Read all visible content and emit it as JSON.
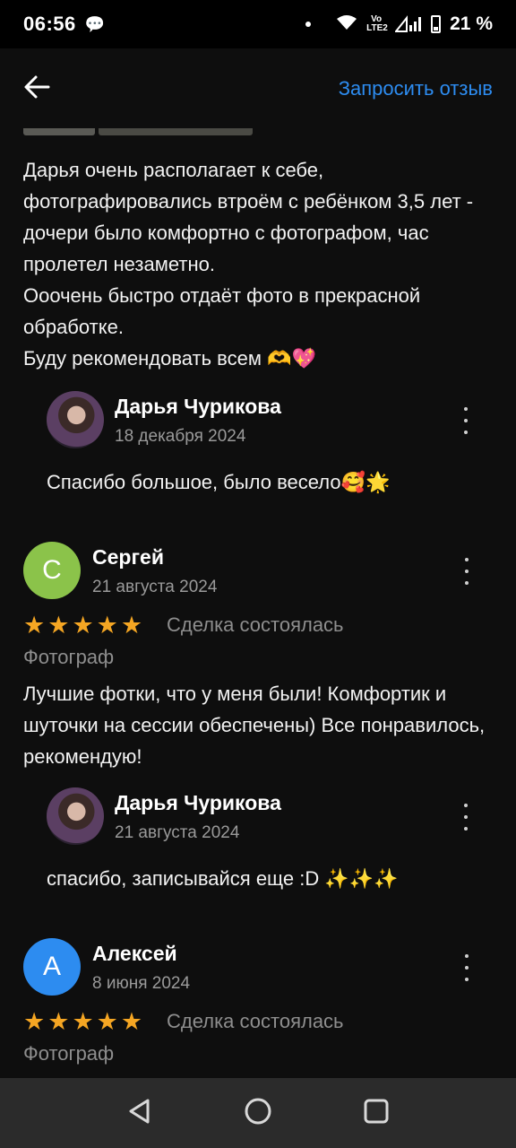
{
  "status": {
    "time": "06:56",
    "volte": "Vo LTE2",
    "battery": "21 %"
  },
  "header": {
    "back_icon": "arrow-left-icon",
    "request_review_label": "Запросить отзыв"
  },
  "reviews": [
    {
      "text": "Дарья очень располагает к себе, фотографировались втроём с ребёнком 3,5 лет - дочери было комфортно с фотографом, час пролетел незаметно.\nОоочень быстро отдаёт фото в прекрасной обработке.\nБуду рекомендовать всем 🫶💖",
      "reply": {
        "author": "Дарья Чурикова",
        "date": "18 декабря 2024",
        "text": "Спасибо большое, было весело🥰🌟"
      }
    },
    {
      "author": "Сергей",
      "initial": "С",
      "avatar_color": "#8bc34a",
      "date": "21 августа 2024",
      "rating": 5,
      "deal_status": "Сделка состоялась",
      "category": "Фотограф",
      "text": "Лучшие фотки, что у меня были! Комфортик и шуточки на сессии обеспечены) Все понравилось, рекомендую!",
      "reply": {
        "author": "Дарья Чурикова",
        "date": "21 августа 2024",
        "text": "спасибо, записывайся еще :D ✨✨✨"
      }
    },
    {
      "author": "Алексей",
      "initial": "А",
      "avatar_color": "#2d8cf0",
      "date": "8 июня 2024",
      "rating": 5,
      "deal_status": "Сделка состоялась",
      "category": "Фотограф"
    }
  ],
  "nav": {
    "back_icon": "triangle-back-icon",
    "home_icon": "circle-home-icon",
    "recents_icon": "square-recents-icon"
  }
}
